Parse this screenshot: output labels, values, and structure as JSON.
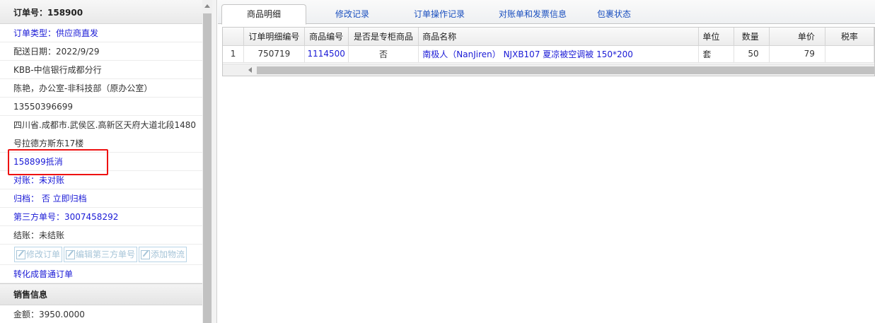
{
  "left_panel": {
    "order_header": "订单号：158900",
    "order_type": "订单类型：供应商直发",
    "delivery_date": "配送日期：2022/9/29",
    "branch": "KBB-中信银行成都分行",
    "contact": "陈艳，办公室-非科技部（原办公室）",
    "phone": "13550396699",
    "address": "四川省.成都市.武侯区.高新区天府大道北段1480号拉德方斯东17楼",
    "offset_link": "158899抵消",
    "reconcile": "对账：未对账",
    "archive": "归档： 否 立即归档",
    "third_party_no": "第三方单号：3007458292",
    "settlement": "结账：未结账",
    "buttons": {
      "edit_order": "修改订单",
      "edit_third_party": "编辑第三方单号",
      "add_logistics": "添加物流"
    },
    "convert_link": "转化成普通订单",
    "sales_header": "销售信息",
    "amount": "金额：3950.0000"
  },
  "tabs": [
    "商品明细",
    "修改记录",
    "订单操作记录",
    "对账单和发票信息",
    "包裹状态"
  ],
  "table": {
    "headers": [
      "",
      "订单明细编号",
      "商品编号",
      "是否是专柜商品",
      "商品名称",
      "单位",
      "数量",
      "单价",
      "税率"
    ],
    "rows": [
      {
        "idx": "1",
        "detail_no": "750719",
        "product_no": "1114500",
        "is_counter": "否",
        "name": "南极人（NanJiren） NJXB107 夏凉被空调被 150*200",
        "unit": "套",
        "qty": "50",
        "price": "79",
        "tax": ""
      }
    ]
  },
  "colors": {
    "link": "#1a1ad6",
    "highlight": "#ee1111",
    "tab_text": "#1a4fbf"
  }
}
